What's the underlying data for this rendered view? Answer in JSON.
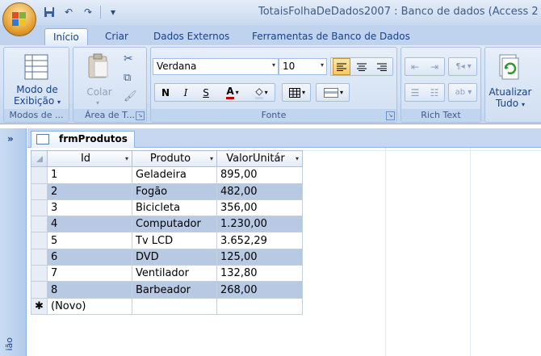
{
  "window": {
    "title": "TotaisFolhaDeDados2007 : Banco de dados (Access 2"
  },
  "quick_access": {
    "items": [
      "save-icon",
      "undo-icon",
      "redo-icon",
      "customize-icon"
    ]
  },
  "tabs": [
    {
      "label": "Início",
      "active": true
    },
    {
      "label": "Criar",
      "active": false
    },
    {
      "label": "Dados Externos",
      "active": false
    },
    {
      "label": "Ferramentas de Banco de Dados",
      "active": false
    }
  ],
  "ribbon": {
    "views": {
      "button_line1": "Modo de",
      "button_line2": "Exibição",
      "group_label": "Modos de ..."
    },
    "clipboard": {
      "paste_label": "Colar",
      "group_label": "Área de T..."
    },
    "font": {
      "family": "Verdana",
      "size": "10",
      "group_label": "Fonte"
    },
    "richtext": {
      "group_label": "Rich Text"
    },
    "records": {
      "refresh_line1": "Atualizar",
      "refresh_line2": "Tudo"
    }
  },
  "navpane": {
    "toggle": "»",
    "label": "ião"
  },
  "document": {
    "tab_label": "frmProdutos"
  },
  "datasheet": {
    "columns": [
      "Id",
      "Produto",
      "ValorUnitár"
    ],
    "rows": [
      {
        "id": "1",
        "produto": "Geladeira",
        "valor": "895,00"
      },
      {
        "id": "2",
        "produto": "Fogão",
        "valor": "482,00"
      },
      {
        "id": "3",
        "produto": "Bicicleta",
        "valor": "356,00"
      },
      {
        "id": "4",
        "produto": "Computador",
        "valor": "1.230,00"
      },
      {
        "id": "5",
        "produto": "Tv LCD",
        "valor": "3.652,29"
      },
      {
        "id": "6",
        "produto": "DVD",
        "valor": "125,00"
      },
      {
        "id": "7",
        "produto": "Ventilador",
        "valor": "132,80"
      },
      {
        "id": "8",
        "produto": "Barbeador",
        "valor": "268,00"
      }
    ],
    "new_row_marker": "✱",
    "new_row_label": "(Novo)"
  },
  "colors": {
    "accent": "#15428b",
    "alt_row": "#b8c9e3",
    "selected_button": "#f8c867"
  }
}
